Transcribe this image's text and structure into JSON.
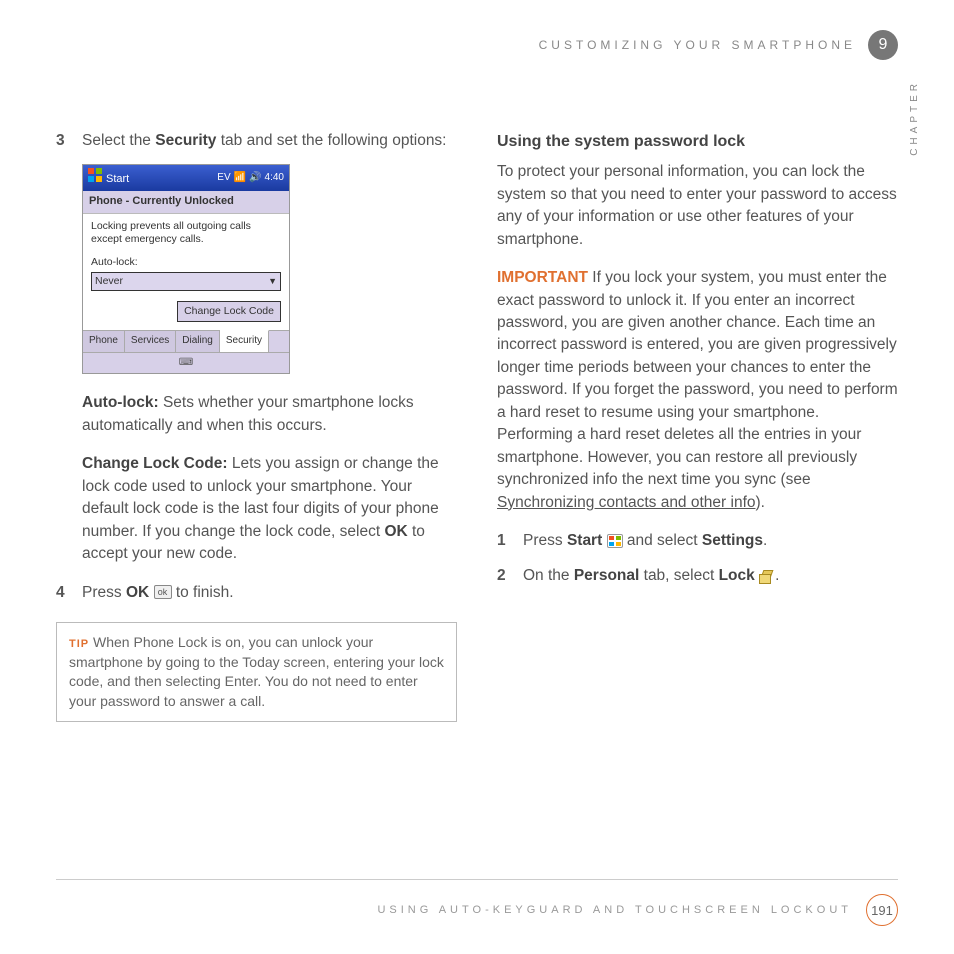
{
  "header": {
    "title": "CUSTOMIZING YOUR SMARTPHONE",
    "chapter_num": "9",
    "chapter_label": "CHAPTER"
  },
  "left": {
    "step3_num": "3",
    "step3_a": "Select the ",
    "step3_b": "Security",
    "step3_c": " tab and set the following options:",
    "screenshot": {
      "start": "Start",
      "time": "4:40",
      "status1": "EV",
      "subtitle": "Phone - Currently Unlocked",
      "desc": "Locking prevents all outgoing calls except emergency calls.",
      "autolock_label": "Auto-lock:",
      "autolock_value": "Never",
      "change_btn": "Change Lock Code",
      "tabs": {
        "phone": "Phone",
        "services": "Services",
        "dialing": "Dialing",
        "security": "Security"
      },
      "kb": "⌨"
    },
    "autolock_head": "Auto-lock:",
    "autolock_body": " Sets whether your smartphone locks automatically and when this occurs.",
    "changecode_head": "Change Lock Code:",
    "changecode_a": " Lets you assign or change the lock code used to unlock your smartphone. Your default lock code is the last four digits of your phone number. If you change the lock code, select ",
    "changecode_ok": "OK",
    "changecode_b": " to accept your new code.",
    "step4_num": "4",
    "step4_a": "Press ",
    "step4_ok": "OK",
    "step4_b": " to finish.",
    "ok_icon_glyph": "ok",
    "tip_label": "TIP",
    "tip_body": " When Phone Lock is on, you can unlock your smartphone by going to the Today screen, entering your lock code, and then selecting Enter. You do not need to enter your password to answer a call."
  },
  "right": {
    "heading": "Using the system password lock",
    "intro": "To protect your personal information, you can lock the system so that you need to enter your password to access any of your information or use other features of your smartphone.",
    "imp_label": "IMPORTANT",
    "imp_a": "  If you lock your system, you must enter the exact password to unlock it. If you enter an incorrect password, you are given another chance. Each time an incorrect password is entered, you are given progressively longer time periods between your chances to enter the password. If you forget the password, you need to perform a hard reset to resume using your smartphone. Performing a hard reset deletes all the entries in your smartphone. However, you can restore all previously synchronized info the next time you sync (see ",
    "imp_link": "Synchronizing contacts and other info",
    "imp_b": ").",
    "step1_num": "1",
    "step1_a": "Press ",
    "step1_start": "Start",
    "step1_b": " and select ",
    "step1_settings": "Settings",
    "step1_c": ".",
    "step2_num": "2",
    "step2_a": "On the ",
    "step2_personal": "Personal",
    "step2_b": " tab, select ",
    "step2_lock": "Lock",
    "step2_c": "."
  },
  "footer": {
    "text": "USING AUTO-KEYGUARD AND TOUCHSCREEN LOCKOUT",
    "page": "191"
  }
}
